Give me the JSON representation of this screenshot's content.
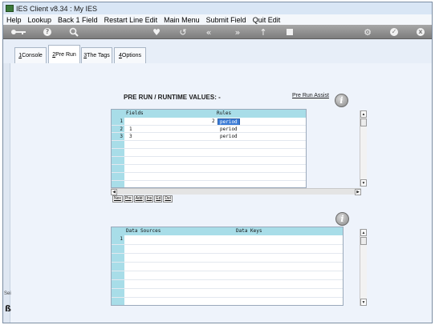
{
  "window": {
    "title": "IES Client v8.34 : My IES"
  },
  "menu": [
    "Help",
    "Lookup",
    "Back 1 Field",
    "Restart Line Edit",
    "Main Menu",
    "Submit Field",
    "Quit Edit"
  ],
  "toolbar": {
    "icons": [
      "key-icon",
      "help-icon",
      "search-icon",
      "heart-icon",
      "undo-icon",
      "rewind-icon",
      "fast-forward-icon",
      "upload-icon",
      "stop-icon",
      "settings-icon",
      "check-icon",
      "close-icon"
    ],
    "help_glyph": "?",
    "check_glyph": "✓",
    "close_glyph": "x"
  },
  "tabs": [
    {
      "key": "1",
      "label": " Console",
      "active": false
    },
    {
      "key": "2",
      "label": " Pre Run",
      "active": true
    },
    {
      "key": "3",
      "label": " The Tags",
      "active": false
    },
    {
      "key": "4",
      "label": " Options",
      "active": false
    }
  ],
  "sidebar": {
    "label": "Sei",
    "glyph": "ß"
  },
  "pre_run": {
    "heading": "PRE RUN / RUNTIME VALUES: -",
    "assist_link": "Pre Run Assist",
    "info_glyph": "i",
    "fields_grid": {
      "headers": {
        "fields": "Fields",
        "rules": "Rules"
      },
      "rows": [
        {
          "num": "1",
          "field": "2",
          "rule": "period"
        },
        {
          "num": "2",
          "field": "1",
          "rule": "period"
        },
        {
          "num": "3",
          "field": "3",
          "rule": "period"
        }
      ]
    },
    "grid_buttons": [
      "Nex",
      "Pre",
      "Add",
      "Ins",
      "Ed",
      "Del"
    ]
  },
  "data_sources": {
    "info_glyph": "i",
    "headers": {
      "sources": "Data Sources",
      "keys": "Data Keys"
    },
    "rows": [
      {
        "num": "1"
      }
    ]
  }
}
